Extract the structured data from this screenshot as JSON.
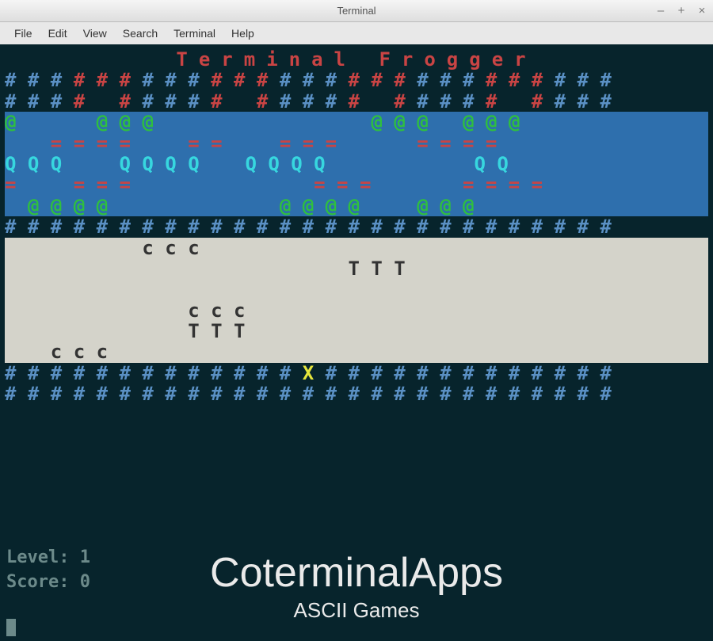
{
  "window": {
    "title": "Terminal",
    "controls": {
      "min": "–",
      "max": "+",
      "close": "×"
    }
  },
  "menubar": [
    "File",
    "Edit",
    "View",
    "Search",
    "Terminal",
    "Help"
  ],
  "game": {
    "title": "Terminal Frogger",
    "rows": [
      {
        "bg": "none",
        "spans": [
          {
            "c": "c-blue",
            "t": "# # # "
          },
          {
            "c": "c-red",
            "t": "# # # "
          },
          {
            "c": "c-blue",
            "t": "# # # "
          },
          {
            "c": "c-red",
            "t": "# # # "
          },
          {
            "c": "c-blue",
            "t": "# # # "
          },
          {
            "c": "c-red",
            "t": "# # # "
          },
          {
            "c": "c-blue",
            "t": "# # # "
          },
          {
            "c": "c-red",
            "t": "# # # "
          },
          {
            "c": "c-blue",
            "t": "# # #"
          }
        ]
      },
      {
        "bg": "none",
        "spans": [
          {
            "c": "c-blue",
            "t": "# # # "
          },
          {
            "c": "c-red",
            "t": "#   # "
          },
          {
            "c": "c-blue",
            "t": "# # # "
          },
          {
            "c": "c-red",
            "t": "#   # "
          },
          {
            "c": "c-blue",
            "t": "# # # "
          },
          {
            "c": "c-red",
            "t": "#   # "
          },
          {
            "c": "c-blue",
            "t": "# # # "
          },
          {
            "c": "c-red",
            "t": "#   # "
          },
          {
            "c": "c-blue",
            "t": "# # #"
          }
        ]
      },
      {
        "bg": "blue",
        "spans": [
          {
            "c": "c-green",
            "t": "@"
          },
          {
            "c": "",
            "t": "       "
          },
          {
            "c": "c-green",
            "t": "@ @ @"
          },
          {
            "c": "",
            "t": "                   "
          },
          {
            "c": "c-green",
            "t": "@ @ @"
          },
          {
            "c": "",
            "t": "   "
          },
          {
            "c": "c-green",
            "t": "@ @ @"
          },
          {
            "c": "",
            "t": "  "
          }
        ]
      },
      {
        "bg": "blue",
        "spans": [
          {
            "c": "",
            "t": "    "
          },
          {
            "c": "c-red",
            "t": "= = = ="
          },
          {
            "c": "",
            "t": "     "
          },
          {
            "c": "c-red",
            "t": "= ="
          },
          {
            "c": "",
            "t": "     "
          },
          {
            "c": "c-red",
            "t": "= = ="
          },
          {
            "c": "",
            "t": "       "
          },
          {
            "c": "c-red",
            "t": "= = = ="
          },
          {
            "c": "",
            "t": "      "
          }
        ]
      },
      {
        "bg": "blue",
        "spans": [
          {
            "c": "c-cyan",
            "t": "Q Q Q"
          },
          {
            "c": "",
            "t": "     "
          },
          {
            "c": "c-cyan",
            "t": "Q Q Q Q"
          },
          {
            "c": "",
            "t": "    "
          },
          {
            "c": "c-cyan",
            "t": "Q Q Q Q"
          },
          {
            "c": "",
            "t": "             "
          },
          {
            "c": "c-cyan",
            "t": "Q Q"
          }
        ]
      },
      {
        "bg": "blue",
        "spans": [
          {
            "c": "c-red",
            "t": "="
          },
          {
            "c": "",
            "t": "     "
          },
          {
            "c": "c-red",
            "t": "= = ="
          },
          {
            "c": "",
            "t": "                "
          },
          {
            "c": "c-red",
            "t": "= = ="
          },
          {
            "c": "",
            "t": "        "
          },
          {
            "c": "c-red",
            "t": "= = = ="
          }
        ]
      },
      {
        "bg": "blue",
        "spans": [
          {
            "c": "",
            "t": "  "
          },
          {
            "c": "c-green",
            "t": "@ @ @ @"
          },
          {
            "c": "",
            "t": "               "
          },
          {
            "c": "c-green",
            "t": "@ @ @ @"
          },
          {
            "c": "",
            "t": "     "
          },
          {
            "c": "c-green",
            "t": "@ @ @"
          },
          {
            "c": "",
            "t": "     "
          }
        ]
      },
      {
        "bg": "none",
        "spans": [
          {
            "c": "c-blue",
            "t": "# # # # # # # # # # # # # # # # # # # # # # # # # # #"
          }
        ]
      },
      {
        "bg": "gray",
        "spans": [
          {
            "c": "c-dark",
            "t": "            c c c                                    "
          }
        ]
      },
      {
        "bg": "gray",
        "spans": [
          {
            "c": "c-dark",
            "t": "                              T T T                  "
          }
        ]
      },
      {
        "bg": "gray",
        "spans": [
          {
            "c": "c-dark",
            "t": "                                                     "
          }
        ]
      },
      {
        "bg": "gray",
        "spans": [
          {
            "c": "c-dark",
            "t": "                c c c                                "
          }
        ]
      },
      {
        "bg": "gray",
        "spans": [
          {
            "c": "c-dark",
            "t": "                T T T                                "
          }
        ]
      },
      {
        "bg": "gray",
        "spans": [
          {
            "c": "c-dark",
            "t": "    c c c                                            "
          }
        ]
      },
      {
        "bg": "none",
        "spans": [
          {
            "c": "c-blue",
            "t": "# # # # # # # # # # # # # "
          },
          {
            "c": "c-yellow",
            "t": "X"
          },
          {
            "c": "c-blue",
            "t": " # # # # # # # # # # # # #"
          }
        ]
      },
      {
        "bg": "none",
        "spans": [
          {
            "c": "c-blue",
            "t": "# # # # # # # # # # # # # # # # # # # # # # # # # # #"
          }
        ]
      }
    ],
    "status": {
      "level_label": "Level:",
      "level_value": "1",
      "score_label": "Score:",
      "score_value": "0"
    }
  },
  "overlay": {
    "brand": "CoterminalApps",
    "subtitle": "ASCII Games"
  }
}
